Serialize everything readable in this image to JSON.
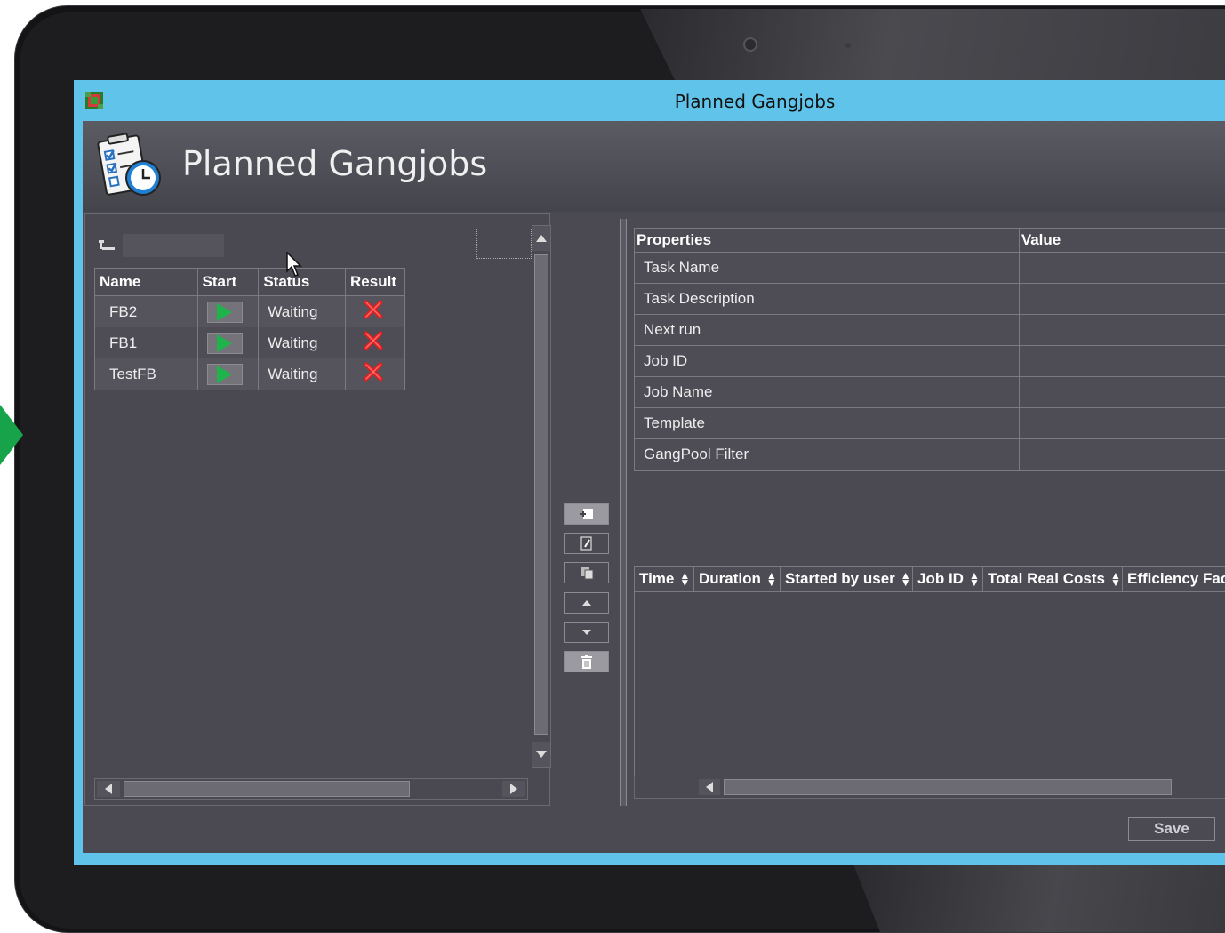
{
  "window": {
    "title": "Planned Gangjobs"
  },
  "header": {
    "title": "Planned Gangjobs"
  },
  "jobs_table": {
    "columns": [
      "Name",
      "Start",
      "Status",
      "Result"
    ],
    "rows": [
      {
        "name": "FB2",
        "status": "Waiting"
      },
      {
        "name": "FB1",
        "status": "Waiting"
      },
      {
        "name": "TestFB",
        "status": "Waiting"
      }
    ]
  },
  "properties_table": {
    "columns": [
      "Properties",
      "Value"
    ],
    "rows": [
      "Task Name",
      "Task Description",
      "Next run",
      "Job ID",
      "Job Name",
      "Template",
      "GangPool Filter"
    ]
  },
  "history_table": {
    "columns": [
      "Time",
      "Duration",
      "Started by user",
      "Job ID",
      "Total Real Costs",
      "Efficiency Fac"
    ]
  },
  "footer": {
    "save_label": "Save"
  },
  "colors": {
    "accent": "#60c4ea",
    "play": "#1fb34b",
    "error": "#e02020"
  },
  "icons": [
    "app-icon",
    "task-list-clock-icon",
    "tree-icon",
    "play-icon",
    "error-x-icon",
    "add-icon",
    "edit-icon",
    "copy-icon",
    "move-up-icon",
    "move-down-icon",
    "trash-icon",
    "mouse-cursor-icon"
  ]
}
